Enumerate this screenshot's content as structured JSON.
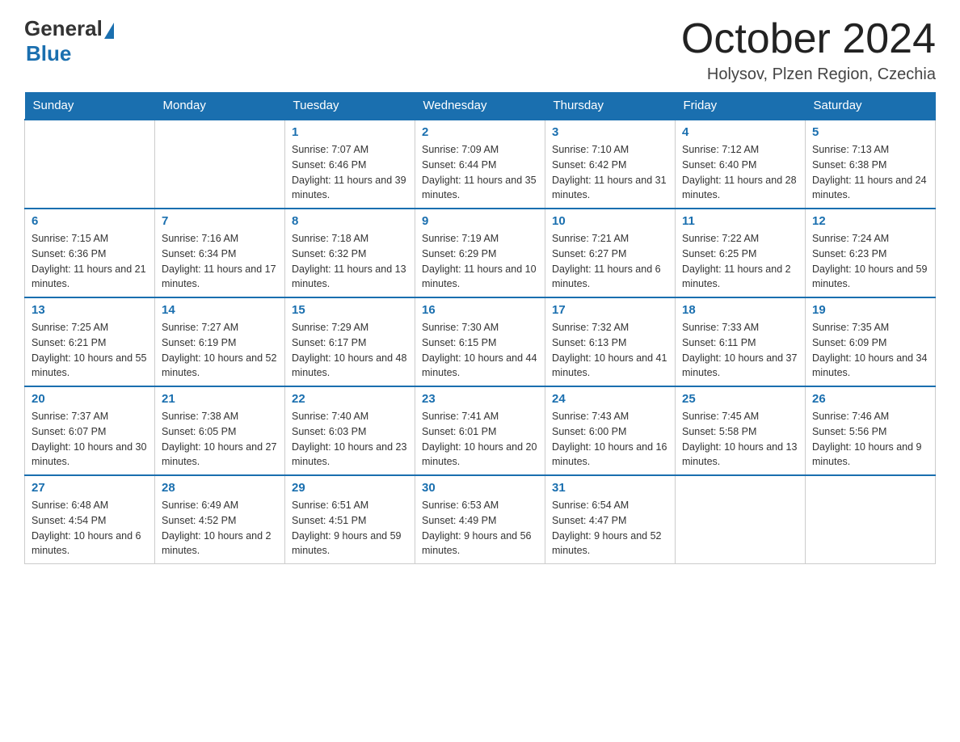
{
  "header": {
    "logo_general": "General",
    "logo_blue": "Blue",
    "month_title": "October 2024",
    "location": "Holysov, Plzen Region, Czechia"
  },
  "days_of_week": [
    "Sunday",
    "Monday",
    "Tuesday",
    "Wednesday",
    "Thursday",
    "Friday",
    "Saturday"
  ],
  "weeks": [
    [
      {
        "day": "",
        "sunrise": "",
        "sunset": "",
        "daylight": ""
      },
      {
        "day": "",
        "sunrise": "",
        "sunset": "",
        "daylight": ""
      },
      {
        "day": "1",
        "sunrise": "Sunrise: 7:07 AM",
        "sunset": "Sunset: 6:46 PM",
        "daylight": "Daylight: 11 hours and 39 minutes."
      },
      {
        "day": "2",
        "sunrise": "Sunrise: 7:09 AM",
        "sunset": "Sunset: 6:44 PM",
        "daylight": "Daylight: 11 hours and 35 minutes."
      },
      {
        "day": "3",
        "sunrise": "Sunrise: 7:10 AM",
        "sunset": "Sunset: 6:42 PM",
        "daylight": "Daylight: 11 hours and 31 minutes."
      },
      {
        "day": "4",
        "sunrise": "Sunrise: 7:12 AM",
        "sunset": "Sunset: 6:40 PM",
        "daylight": "Daylight: 11 hours and 28 minutes."
      },
      {
        "day": "5",
        "sunrise": "Sunrise: 7:13 AM",
        "sunset": "Sunset: 6:38 PM",
        "daylight": "Daylight: 11 hours and 24 minutes."
      }
    ],
    [
      {
        "day": "6",
        "sunrise": "Sunrise: 7:15 AM",
        "sunset": "Sunset: 6:36 PM",
        "daylight": "Daylight: 11 hours and 21 minutes."
      },
      {
        "day": "7",
        "sunrise": "Sunrise: 7:16 AM",
        "sunset": "Sunset: 6:34 PM",
        "daylight": "Daylight: 11 hours and 17 minutes."
      },
      {
        "day": "8",
        "sunrise": "Sunrise: 7:18 AM",
        "sunset": "Sunset: 6:32 PM",
        "daylight": "Daylight: 11 hours and 13 minutes."
      },
      {
        "day": "9",
        "sunrise": "Sunrise: 7:19 AM",
        "sunset": "Sunset: 6:29 PM",
        "daylight": "Daylight: 11 hours and 10 minutes."
      },
      {
        "day": "10",
        "sunrise": "Sunrise: 7:21 AM",
        "sunset": "Sunset: 6:27 PM",
        "daylight": "Daylight: 11 hours and 6 minutes."
      },
      {
        "day": "11",
        "sunrise": "Sunrise: 7:22 AM",
        "sunset": "Sunset: 6:25 PM",
        "daylight": "Daylight: 11 hours and 2 minutes."
      },
      {
        "day": "12",
        "sunrise": "Sunrise: 7:24 AM",
        "sunset": "Sunset: 6:23 PM",
        "daylight": "Daylight: 10 hours and 59 minutes."
      }
    ],
    [
      {
        "day": "13",
        "sunrise": "Sunrise: 7:25 AM",
        "sunset": "Sunset: 6:21 PM",
        "daylight": "Daylight: 10 hours and 55 minutes."
      },
      {
        "day": "14",
        "sunrise": "Sunrise: 7:27 AM",
        "sunset": "Sunset: 6:19 PM",
        "daylight": "Daylight: 10 hours and 52 minutes."
      },
      {
        "day": "15",
        "sunrise": "Sunrise: 7:29 AM",
        "sunset": "Sunset: 6:17 PM",
        "daylight": "Daylight: 10 hours and 48 minutes."
      },
      {
        "day": "16",
        "sunrise": "Sunrise: 7:30 AM",
        "sunset": "Sunset: 6:15 PM",
        "daylight": "Daylight: 10 hours and 44 minutes."
      },
      {
        "day": "17",
        "sunrise": "Sunrise: 7:32 AM",
        "sunset": "Sunset: 6:13 PM",
        "daylight": "Daylight: 10 hours and 41 minutes."
      },
      {
        "day": "18",
        "sunrise": "Sunrise: 7:33 AM",
        "sunset": "Sunset: 6:11 PM",
        "daylight": "Daylight: 10 hours and 37 minutes."
      },
      {
        "day": "19",
        "sunrise": "Sunrise: 7:35 AM",
        "sunset": "Sunset: 6:09 PM",
        "daylight": "Daylight: 10 hours and 34 minutes."
      }
    ],
    [
      {
        "day": "20",
        "sunrise": "Sunrise: 7:37 AM",
        "sunset": "Sunset: 6:07 PM",
        "daylight": "Daylight: 10 hours and 30 minutes."
      },
      {
        "day": "21",
        "sunrise": "Sunrise: 7:38 AM",
        "sunset": "Sunset: 6:05 PM",
        "daylight": "Daylight: 10 hours and 27 minutes."
      },
      {
        "day": "22",
        "sunrise": "Sunrise: 7:40 AM",
        "sunset": "Sunset: 6:03 PM",
        "daylight": "Daylight: 10 hours and 23 minutes."
      },
      {
        "day": "23",
        "sunrise": "Sunrise: 7:41 AM",
        "sunset": "Sunset: 6:01 PM",
        "daylight": "Daylight: 10 hours and 20 minutes."
      },
      {
        "day": "24",
        "sunrise": "Sunrise: 7:43 AM",
        "sunset": "Sunset: 6:00 PM",
        "daylight": "Daylight: 10 hours and 16 minutes."
      },
      {
        "day": "25",
        "sunrise": "Sunrise: 7:45 AM",
        "sunset": "Sunset: 5:58 PM",
        "daylight": "Daylight: 10 hours and 13 minutes."
      },
      {
        "day": "26",
        "sunrise": "Sunrise: 7:46 AM",
        "sunset": "Sunset: 5:56 PM",
        "daylight": "Daylight: 10 hours and 9 minutes."
      }
    ],
    [
      {
        "day": "27",
        "sunrise": "Sunrise: 6:48 AM",
        "sunset": "Sunset: 4:54 PM",
        "daylight": "Daylight: 10 hours and 6 minutes."
      },
      {
        "day": "28",
        "sunrise": "Sunrise: 6:49 AM",
        "sunset": "Sunset: 4:52 PM",
        "daylight": "Daylight: 10 hours and 2 minutes."
      },
      {
        "day": "29",
        "sunrise": "Sunrise: 6:51 AM",
        "sunset": "Sunset: 4:51 PM",
        "daylight": "Daylight: 9 hours and 59 minutes."
      },
      {
        "day": "30",
        "sunrise": "Sunrise: 6:53 AM",
        "sunset": "Sunset: 4:49 PM",
        "daylight": "Daylight: 9 hours and 56 minutes."
      },
      {
        "day": "31",
        "sunrise": "Sunrise: 6:54 AM",
        "sunset": "Sunset: 4:47 PM",
        "daylight": "Daylight: 9 hours and 52 minutes."
      },
      {
        "day": "",
        "sunrise": "",
        "sunset": "",
        "daylight": ""
      },
      {
        "day": "",
        "sunrise": "",
        "sunset": "",
        "daylight": ""
      }
    ]
  ]
}
